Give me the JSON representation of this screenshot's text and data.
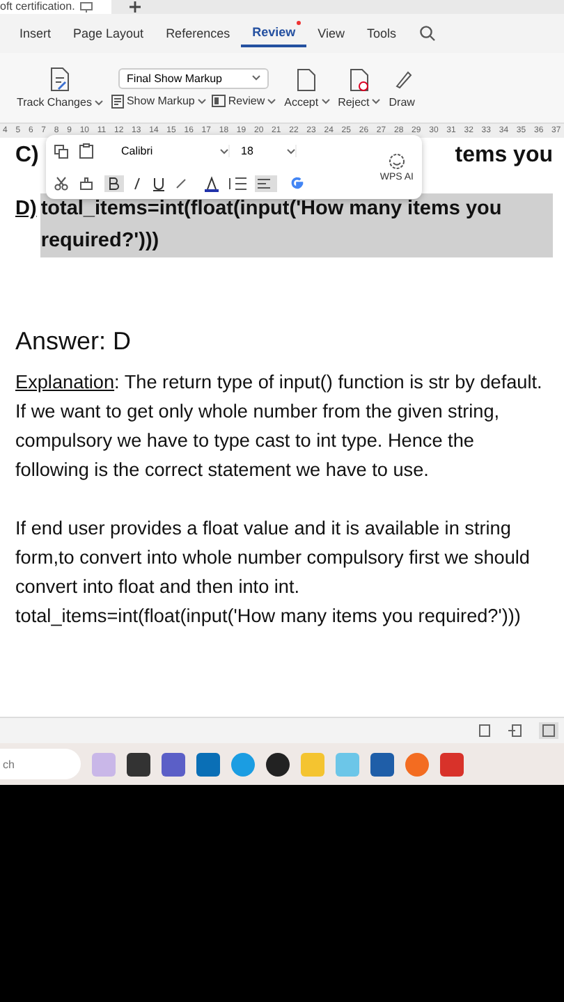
{
  "doc_tab": {
    "label": "oft certification."
  },
  "menu_tabs": [
    {
      "label": "Insert",
      "selected": false,
      "notify": false
    },
    {
      "label": "Page Layout",
      "selected": false,
      "notify": false
    },
    {
      "label": "References",
      "selected": false,
      "notify": false
    },
    {
      "label": "Review",
      "selected": true,
      "notify": true
    },
    {
      "label": "View",
      "selected": false,
      "notify": false
    },
    {
      "label": "Tools",
      "selected": false,
      "notify": false
    }
  ],
  "toolbar": {
    "markup_dropdown": "Final Show Markup",
    "track_changes": "Track Changes",
    "show_markup": "Show Markup",
    "review": "Review",
    "accept": "Accept",
    "reject": "Reject",
    "draw": "Draw"
  },
  "ruler": [
    "4",
    "5",
    "6",
    "7",
    "8",
    "9",
    "10",
    "11",
    "12",
    "13",
    "14",
    "15",
    "16",
    "17",
    "18",
    "19",
    "20",
    "21",
    "22",
    "23",
    "24",
    "25",
    "26",
    "27",
    "28",
    "29",
    "30",
    "31",
    "32",
    "33",
    "34",
    "35",
    "36",
    "37"
  ],
  "floating_toolbar": {
    "font": "Calibri",
    "size": "18",
    "ai_label": "WPS AI"
  },
  "document": {
    "option_c_start": "C)",
    "option_c_end": "tems you",
    "option_d_letter": "D)",
    "option_d_text": "total_items=int(float(input('How many items you required?')))",
    "option_d_selected": true,
    "answer": "Answer: D",
    "explanation_label": "Explanation",
    "explanation": ": The return type of input() function is str by default. If we want to get only whole number from the given string, compulsory we have to type cast to int type. Hence the following is the correct statement we have to use.",
    "paragraph": "If end user provides a float value and it is available in string form,to convert into whole number compulsory first we should convert into float and then into int.",
    "code": "total_items=int(float(input('How many items you required?')))"
  },
  "taskbar": {
    "search_placeholder": "ch"
  }
}
